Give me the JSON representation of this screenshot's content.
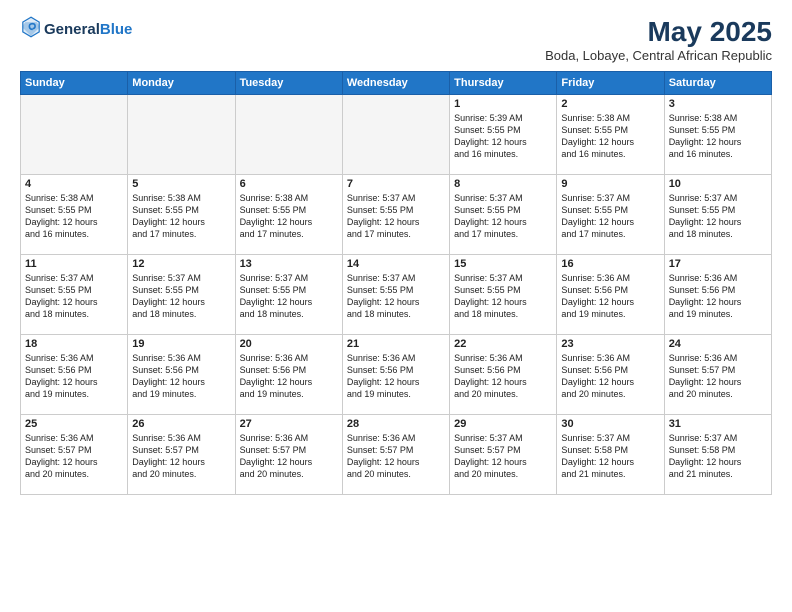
{
  "header": {
    "logo_general": "General",
    "logo_blue": "Blue",
    "month": "May 2025",
    "location": "Boda, Lobaye, Central African Republic"
  },
  "days_of_week": [
    "Sunday",
    "Monday",
    "Tuesday",
    "Wednesday",
    "Thursday",
    "Friday",
    "Saturday"
  ],
  "weeks": [
    [
      {
        "day": "",
        "text": "",
        "empty": true
      },
      {
        "day": "",
        "text": "",
        "empty": true
      },
      {
        "day": "",
        "text": "",
        "empty": true
      },
      {
        "day": "",
        "text": "",
        "empty": true
      },
      {
        "day": "1",
        "text": "Sunrise: 5:39 AM\nSunset: 5:55 PM\nDaylight: 12 hours\nand 16 minutes.",
        "empty": false
      },
      {
        "day": "2",
        "text": "Sunrise: 5:38 AM\nSunset: 5:55 PM\nDaylight: 12 hours\nand 16 minutes.",
        "empty": false
      },
      {
        "day": "3",
        "text": "Sunrise: 5:38 AM\nSunset: 5:55 PM\nDaylight: 12 hours\nand 16 minutes.",
        "empty": false
      }
    ],
    [
      {
        "day": "4",
        "text": "Sunrise: 5:38 AM\nSunset: 5:55 PM\nDaylight: 12 hours\nand 16 minutes.",
        "empty": false
      },
      {
        "day": "5",
        "text": "Sunrise: 5:38 AM\nSunset: 5:55 PM\nDaylight: 12 hours\nand 17 minutes.",
        "empty": false
      },
      {
        "day": "6",
        "text": "Sunrise: 5:38 AM\nSunset: 5:55 PM\nDaylight: 12 hours\nand 17 minutes.",
        "empty": false
      },
      {
        "day": "7",
        "text": "Sunrise: 5:37 AM\nSunset: 5:55 PM\nDaylight: 12 hours\nand 17 minutes.",
        "empty": false
      },
      {
        "day": "8",
        "text": "Sunrise: 5:37 AM\nSunset: 5:55 PM\nDaylight: 12 hours\nand 17 minutes.",
        "empty": false
      },
      {
        "day": "9",
        "text": "Sunrise: 5:37 AM\nSunset: 5:55 PM\nDaylight: 12 hours\nand 17 minutes.",
        "empty": false
      },
      {
        "day": "10",
        "text": "Sunrise: 5:37 AM\nSunset: 5:55 PM\nDaylight: 12 hours\nand 18 minutes.",
        "empty": false
      }
    ],
    [
      {
        "day": "11",
        "text": "Sunrise: 5:37 AM\nSunset: 5:55 PM\nDaylight: 12 hours\nand 18 minutes.",
        "empty": false
      },
      {
        "day": "12",
        "text": "Sunrise: 5:37 AM\nSunset: 5:55 PM\nDaylight: 12 hours\nand 18 minutes.",
        "empty": false
      },
      {
        "day": "13",
        "text": "Sunrise: 5:37 AM\nSunset: 5:55 PM\nDaylight: 12 hours\nand 18 minutes.",
        "empty": false
      },
      {
        "day": "14",
        "text": "Sunrise: 5:37 AM\nSunset: 5:55 PM\nDaylight: 12 hours\nand 18 minutes.",
        "empty": false
      },
      {
        "day": "15",
        "text": "Sunrise: 5:37 AM\nSunset: 5:55 PM\nDaylight: 12 hours\nand 18 minutes.",
        "empty": false
      },
      {
        "day": "16",
        "text": "Sunrise: 5:36 AM\nSunset: 5:56 PM\nDaylight: 12 hours\nand 19 minutes.",
        "empty": false
      },
      {
        "day": "17",
        "text": "Sunrise: 5:36 AM\nSunset: 5:56 PM\nDaylight: 12 hours\nand 19 minutes.",
        "empty": false
      }
    ],
    [
      {
        "day": "18",
        "text": "Sunrise: 5:36 AM\nSunset: 5:56 PM\nDaylight: 12 hours\nand 19 minutes.",
        "empty": false
      },
      {
        "day": "19",
        "text": "Sunrise: 5:36 AM\nSunset: 5:56 PM\nDaylight: 12 hours\nand 19 minutes.",
        "empty": false
      },
      {
        "day": "20",
        "text": "Sunrise: 5:36 AM\nSunset: 5:56 PM\nDaylight: 12 hours\nand 19 minutes.",
        "empty": false
      },
      {
        "day": "21",
        "text": "Sunrise: 5:36 AM\nSunset: 5:56 PM\nDaylight: 12 hours\nand 19 minutes.",
        "empty": false
      },
      {
        "day": "22",
        "text": "Sunrise: 5:36 AM\nSunset: 5:56 PM\nDaylight: 12 hours\nand 20 minutes.",
        "empty": false
      },
      {
        "day": "23",
        "text": "Sunrise: 5:36 AM\nSunset: 5:56 PM\nDaylight: 12 hours\nand 20 minutes.",
        "empty": false
      },
      {
        "day": "24",
        "text": "Sunrise: 5:36 AM\nSunset: 5:57 PM\nDaylight: 12 hours\nand 20 minutes.",
        "empty": false
      }
    ],
    [
      {
        "day": "25",
        "text": "Sunrise: 5:36 AM\nSunset: 5:57 PM\nDaylight: 12 hours\nand 20 minutes.",
        "empty": false
      },
      {
        "day": "26",
        "text": "Sunrise: 5:36 AM\nSunset: 5:57 PM\nDaylight: 12 hours\nand 20 minutes.",
        "empty": false
      },
      {
        "day": "27",
        "text": "Sunrise: 5:36 AM\nSunset: 5:57 PM\nDaylight: 12 hours\nand 20 minutes.",
        "empty": false
      },
      {
        "day": "28",
        "text": "Sunrise: 5:36 AM\nSunset: 5:57 PM\nDaylight: 12 hours\nand 20 minutes.",
        "empty": false
      },
      {
        "day": "29",
        "text": "Sunrise: 5:37 AM\nSunset: 5:57 PM\nDaylight: 12 hours\nand 20 minutes.",
        "empty": false
      },
      {
        "day": "30",
        "text": "Sunrise: 5:37 AM\nSunset: 5:58 PM\nDaylight: 12 hours\nand 21 minutes.",
        "empty": false
      },
      {
        "day": "31",
        "text": "Sunrise: 5:37 AM\nSunset: 5:58 PM\nDaylight: 12 hours\nand 21 minutes.",
        "empty": false
      }
    ]
  ]
}
